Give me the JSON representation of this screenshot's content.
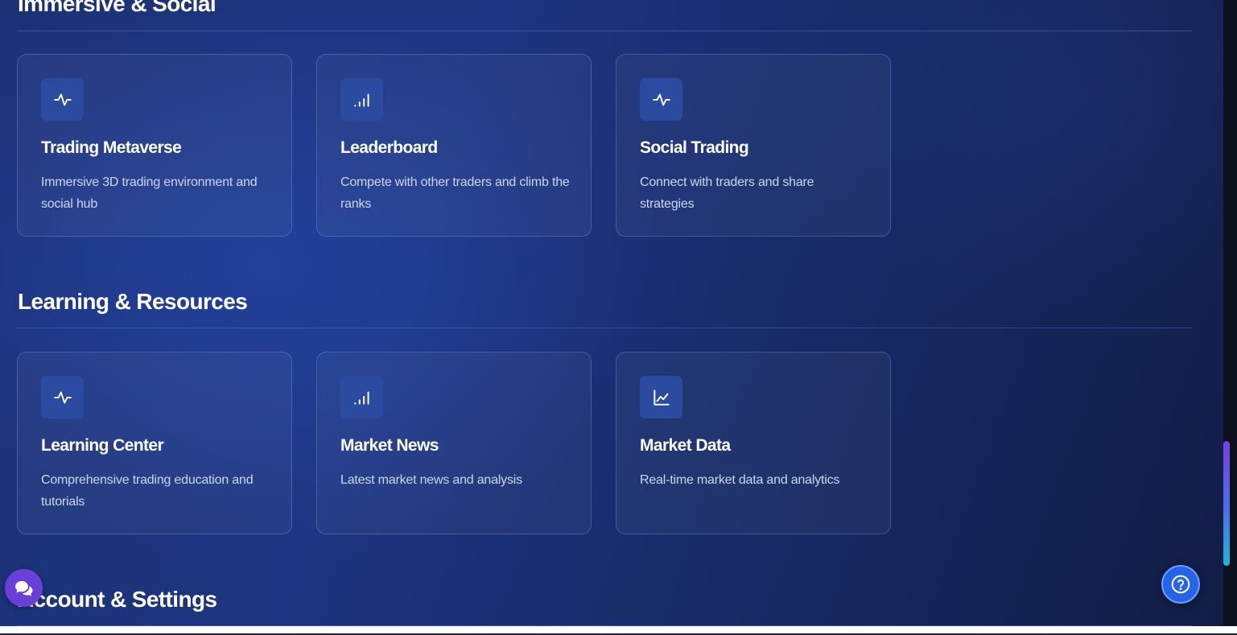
{
  "sections": [
    {
      "title": "Immersive & Social",
      "cards": [
        {
          "icon": "activity-icon",
          "title": "Trading Metaverse",
          "description": "Immersive 3D trading environment and social hub"
        },
        {
          "icon": "signal-bars-icon",
          "title": "Leaderboard",
          "description": "Compete with other traders and climb the ranks"
        },
        {
          "icon": "activity-icon",
          "title": "Social Trading",
          "description": "Connect with traders and share strategies"
        }
      ]
    },
    {
      "title": "Learning & Resources",
      "cards": [
        {
          "icon": "activity-icon",
          "title": "Learning Center",
          "description": "Comprehensive trading education and tutorials"
        },
        {
          "icon": "signal-bars-icon",
          "title": "Market News",
          "description": "Latest market news and analysis"
        },
        {
          "icon": "line-chart-icon",
          "title": "Market Data",
          "description": "Real-time market data and analytics"
        }
      ]
    },
    {
      "title": "Account & Settings",
      "cards": []
    }
  ],
  "floating": {
    "chat_icon": "chat-bubbles-icon",
    "help_icon": "help-circle-icon"
  },
  "colors": {
    "background": "#1d3580",
    "card_border": "#5a6fb4",
    "icon_box": "#2a4ba0",
    "chat_button": "#6a3fd8",
    "help_button": "#2563eb"
  }
}
